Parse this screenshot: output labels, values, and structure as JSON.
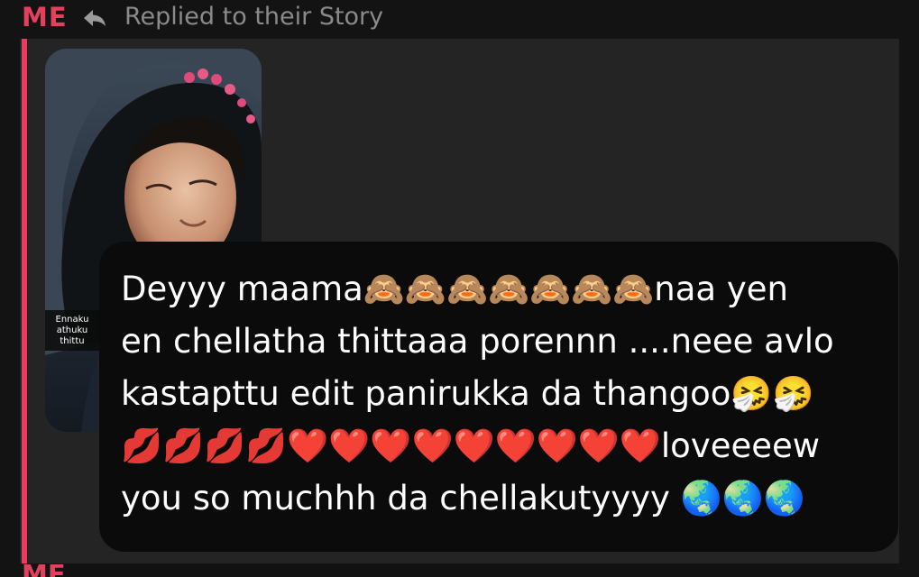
{
  "header": {
    "sender": "ME",
    "reply_icon": "reply-arrow-icon",
    "reply_status": "Replied to their Story"
  },
  "story": {
    "caption": "Ennaku\nathuku\nthittu"
  },
  "message": {
    "text": "Deyyy maama🙈🙈🙈🙈🙈🙈🙈naa yen\nen chellatha thittaaa porennn ....neee avlo\nkastapttu edit panirukka da thangoo🤧🤧\n💋💋💋💋❤️❤️❤️❤️❤️❤️❤️❤️❤️loveeeew\nyou so muchhh da chellakutyyyy 🌏🌏🌏"
  },
  "next_message": {
    "sender": "ME"
  },
  "colors": {
    "accent": "#e4405e",
    "background": "#131313",
    "thread_background": "#242424",
    "bubble_background": "#0b0b0b",
    "muted_text": "#8a8a8a"
  }
}
